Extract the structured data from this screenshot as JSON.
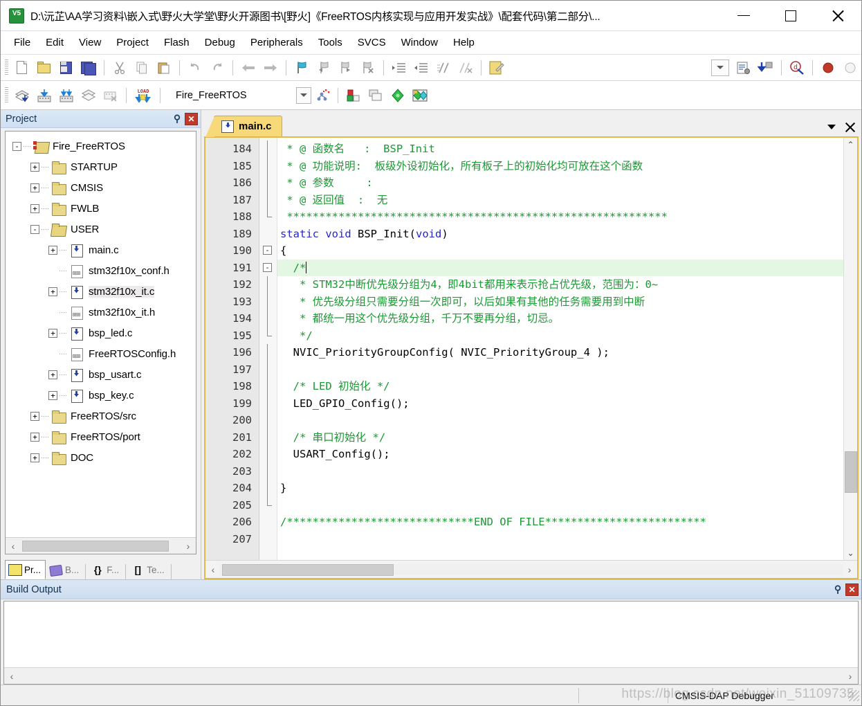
{
  "window": {
    "title": "D:\\沅芷\\AA学习资料\\嵌入式\\野火大学堂\\野火开源图书\\[野火]《FreeRTOS内核实现与应用开发实战》\\配套代码\\第二部分\\...",
    "logo_text": "V5",
    "minimize_label": "Minimize",
    "maximize_label": "Maximize",
    "close_label": "Close"
  },
  "menubar": {
    "items": [
      {
        "label": "File"
      },
      {
        "label": "Edit"
      },
      {
        "label": "View"
      },
      {
        "label": "Project"
      },
      {
        "label": "Flash"
      },
      {
        "label": "Debug"
      },
      {
        "label": "Peripherals"
      },
      {
        "label": "Tools"
      },
      {
        "label": "SVCS"
      },
      {
        "label": "Window"
      },
      {
        "label": "Help"
      }
    ]
  },
  "toolbar_main": {
    "buttons": [
      {
        "name": "new-file-icon",
        "tip": "New"
      },
      {
        "name": "open-file-icon",
        "tip": "Open"
      },
      {
        "name": "save-icon",
        "tip": "Save"
      },
      {
        "name": "save-all-icon",
        "tip": "Save All"
      },
      {
        "name": "cut-icon",
        "tip": "Cut"
      },
      {
        "name": "copy-icon",
        "tip": "Copy"
      },
      {
        "name": "paste-icon",
        "tip": "Paste"
      },
      {
        "name": "undo-icon",
        "tip": "Undo"
      },
      {
        "name": "redo-icon",
        "tip": "Redo"
      },
      {
        "name": "navigate-back-icon",
        "tip": "Back"
      },
      {
        "name": "navigate-forward-icon",
        "tip": "Forward"
      },
      {
        "name": "bookmark-toggle-icon",
        "tip": "Insert/Remove Bookmark"
      },
      {
        "name": "bookmark-prev-icon",
        "tip": "Go to Previous Bookmark"
      },
      {
        "name": "bookmark-next-icon",
        "tip": "Go to Next Bookmark"
      },
      {
        "name": "bookmark-clear-icon",
        "tip": "Clear All Bookmarks"
      },
      {
        "name": "indent-icon",
        "tip": "Indent"
      },
      {
        "name": "outdent-icon",
        "tip": "Outdent"
      },
      {
        "name": "comment-icon",
        "tip": "Comment Selection"
      },
      {
        "name": "uncomment-icon",
        "tip": "Uncomment Selection"
      },
      {
        "name": "configuration-wizard-icon",
        "tip": "Configuration Wizard"
      }
    ],
    "right_buttons": [
      {
        "name": "combo-chevron-icon",
        "tip": "Select"
      },
      {
        "name": "debug-settings-icon",
        "tip": "Debug Settings"
      },
      {
        "name": "download-icon",
        "tip": "Download"
      },
      {
        "name": "start-debug-icon",
        "tip": "Start/Stop Debug Session"
      },
      {
        "name": "record-icon",
        "tip": "Record"
      },
      {
        "name": "stop-icon",
        "tip": "Stop"
      }
    ]
  },
  "toolbar_build": {
    "buttons": [
      {
        "name": "translate-icon",
        "tip": "Translate Current File"
      },
      {
        "name": "build-icon",
        "tip": "Build"
      },
      {
        "name": "rebuild-icon",
        "tip": "Rebuild All"
      },
      {
        "name": "batch-build-icon",
        "tip": "Batch Build"
      },
      {
        "name": "stop-build-icon",
        "tip": "Stop Build"
      },
      {
        "name": "load-icon",
        "tip": "Download Code to Flash Memory"
      }
    ],
    "project_name": "Fire_FreeRTOS",
    "right_buttons": [
      {
        "name": "select-target-chevron-icon",
        "tip": "Select Target"
      },
      {
        "name": "manage-run-time-icon",
        "tip": "Manage Run-Time Environment"
      },
      {
        "name": "options-target-icon",
        "tip": "Options for Target"
      },
      {
        "name": "multi-project-icon",
        "tip": "Manage Multi-Project Workspace"
      },
      {
        "name": "pack-installer-icon",
        "tip": "Pack Installer"
      },
      {
        "name": "manage-project-items-icon",
        "tip": "Manage Project Items"
      }
    ]
  },
  "project_panel": {
    "title": "Project",
    "pin_label": "⚲",
    "close_label": "✕",
    "tree": [
      {
        "label": "Fire_FreeRTOS",
        "depth": 0,
        "expander": "-",
        "icon": "project-root-icon",
        "selected": false
      },
      {
        "label": "STARTUP",
        "depth": 1,
        "expander": "+",
        "icon": "folder-icon",
        "selected": false
      },
      {
        "label": "CMSIS",
        "depth": 1,
        "expander": "+",
        "icon": "folder-icon",
        "selected": false
      },
      {
        "label": "FWLB",
        "depth": 1,
        "expander": "+",
        "icon": "folder-icon",
        "selected": false
      },
      {
        "label": "USER",
        "depth": 1,
        "expander": "-",
        "icon": "folder-open-icon",
        "selected": false
      },
      {
        "label": "main.c",
        "depth": 2,
        "expander": "+",
        "icon": "c-file-icon",
        "selected": false
      },
      {
        "label": "stm32f10x_conf.h",
        "depth": 2,
        "expander": "",
        "icon": "h-file-icon",
        "selected": false
      },
      {
        "label": "stm32f10x_it.c",
        "depth": 2,
        "expander": "+",
        "icon": "c-file-icon",
        "selected": true
      },
      {
        "label": "stm32f10x_it.h",
        "depth": 2,
        "expander": "",
        "icon": "h-file-icon",
        "selected": false
      },
      {
        "label": "bsp_led.c",
        "depth": 2,
        "expander": "+",
        "icon": "c-file-icon",
        "selected": false
      },
      {
        "label": "FreeRTOSConfig.h",
        "depth": 2,
        "expander": "",
        "icon": "h-file-icon",
        "selected": false
      },
      {
        "label": "bsp_usart.c",
        "depth": 2,
        "expander": "+",
        "icon": "c-file-icon",
        "selected": false
      },
      {
        "label": "bsp_key.c",
        "depth": 2,
        "expander": "+",
        "icon": "c-file-icon",
        "selected": false
      },
      {
        "label": "FreeRTOS/src",
        "depth": 1,
        "expander": "+",
        "icon": "folder-icon",
        "selected": false
      },
      {
        "label": "FreeRTOS/port",
        "depth": 1,
        "expander": "+",
        "icon": "folder-icon",
        "selected": false
      },
      {
        "label": "DOC",
        "depth": 1,
        "expander": "+",
        "icon": "folder-icon",
        "selected": false
      }
    ],
    "tabs": [
      {
        "label": "Pr...",
        "icon": "project-tab-icon",
        "active": true
      },
      {
        "label": "B...",
        "icon": "books-tab-icon",
        "active": false
      },
      {
        "label": "F...",
        "icon": "functions-tab-icon",
        "active": false
      },
      {
        "label": "Te...",
        "icon": "templates-tab-icon",
        "active": false
      }
    ],
    "scroll_left_label": "‹",
    "scroll_right_label": "›"
  },
  "editor": {
    "tabs": [
      {
        "label": "main.c",
        "active": true,
        "icon": "c-file-icon"
      }
    ],
    "tab_menu_label": "▼",
    "tab_close_label": "✕",
    "first_line_number": 184,
    "lines": [
      {
        "n": 184,
        "fold": "bar",
        "segments": [
          {
            "t": " * @ 函数名   :  BSP_Init",
            "c": "cmt"
          }
        ]
      },
      {
        "n": 185,
        "fold": "bar",
        "segments": [
          {
            "t": " * @ 功能说明:  板级外设初始化，所有板子上的初始化均可放在这个函数",
            "c": "cmt"
          }
        ]
      },
      {
        "n": 186,
        "fold": "bar",
        "segments": [
          {
            "t": " * @ 参数     :",
            "c": "cmt"
          }
        ]
      },
      {
        "n": 187,
        "fold": "bar",
        "segments": [
          {
            "t": " * @ 返回值  :  无",
            "c": "cmt"
          }
        ]
      },
      {
        "n": 188,
        "fold": "end",
        "segments": [
          {
            "t": " ***********************************************************",
            "c": "cmt"
          }
        ]
      },
      {
        "n": 189,
        "fold": "",
        "segments": [
          {
            "t": "static void ",
            "c": "kw"
          },
          {
            "t": "BSP_Init(",
            "c": "txt"
          },
          {
            "t": "void",
            "c": "kw"
          },
          {
            "t": ")",
            "c": "txt"
          }
        ]
      },
      {
        "n": 190,
        "fold": "box-minus",
        "segments": [
          {
            "t": "{",
            "c": "txt"
          }
        ]
      },
      {
        "n": 191,
        "fold": "box-minus",
        "current": true,
        "caret": true,
        "segments": [
          {
            "t": "  /*",
            "c": "cmt"
          }
        ]
      },
      {
        "n": 192,
        "fold": "bar",
        "segments": [
          {
            "t": "   * STM32中断优先级分组为4，即4bit都用来表示抢占优先级，范围为：0~",
            "c": "cmt"
          }
        ]
      },
      {
        "n": 193,
        "fold": "bar",
        "segments": [
          {
            "t": "   * 优先级分组只需要分组一次即可，以后如果有其他的任务需要用到中断",
            "c": "cmt"
          }
        ]
      },
      {
        "n": 194,
        "fold": "bar",
        "segments": [
          {
            "t": "   * 都统一用这个优先级分组，千万不要再分组，切忌。",
            "c": "cmt"
          }
        ]
      },
      {
        "n": 195,
        "fold": "end",
        "segments": [
          {
            "t": "   */",
            "c": "cmt"
          }
        ]
      },
      {
        "n": 196,
        "fold": "bar",
        "segments": [
          {
            "t": "  NVIC_PriorityGroupConfig( NVIC_PriorityGroup_4 );",
            "c": "txt"
          }
        ]
      },
      {
        "n": 197,
        "fold": "bar",
        "segments": [
          {
            "t": "",
            "c": "txt"
          }
        ]
      },
      {
        "n": 198,
        "fold": "bar",
        "segments": [
          {
            "t": "  /* LED 初始化 */",
            "c": "cmt"
          }
        ]
      },
      {
        "n": 199,
        "fold": "bar",
        "segments": [
          {
            "t": "  LED_GPIO_Config();",
            "c": "txt"
          }
        ]
      },
      {
        "n": 200,
        "fold": "bar",
        "segments": [
          {
            "t": "",
            "c": "txt"
          }
        ]
      },
      {
        "n": 201,
        "fold": "bar",
        "segments": [
          {
            "t": "  /* 串口初始化 */",
            "c": "cmt"
          }
        ]
      },
      {
        "n": 202,
        "fold": "bar",
        "segments": [
          {
            "t": "  USART_Config();",
            "c": "txt"
          }
        ]
      },
      {
        "n": 203,
        "fold": "bar",
        "segments": [
          {
            "t": "",
            "c": "txt"
          }
        ]
      },
      {
        "n": 204,
        "fold": "bar",
        "segments": [
          {
            "t": "}",
            "c": "txt"
          }
        ]
      },
      {
        "n": 205,
        "fold": "end",
        "segments": [
          {
            "t": "",
            "c": "txt"
          }
        ]
      },
      {
        "n": 206,
        "fold": "",
        "segments": [
          {
            "t": "/*****************************END OF FILE*************************",
            "c": "cmt"
          }
        ]
      },
      {
        "n": 207,
        "fold": "",
        "segments": [
          {
            "t": "",
            "c": "txt"
          }
        ]
      }
    ],
    "scroll_up_label": "⌃",
    "scroll_down_label": "⌄",
    "scroll_left_label": "‹",
    "scroll_right_label": "›"
  },
  "build_output": {
    "title": "Build Output",
    "pin_label": "⚲",
    "close_label": "✕",
    "text": "",
    "scroll_left_label": "‹",
    "scroll_right_label": "›"
  },
  "statusbar": {
    "debugger": "CMSIS-DAP Debugger",
    "watermark": "https://blog.csdn.net/weixin_51109735"
  },
  "colors": {
    "comment_green": "#1a9a32",
    "keyword_blue": "#2525cc",
    "tab_yellow": "#f7d97a",
    "caption_blue": "#cfe0f2",
    "current_line": "#e3f7e3"
  }
}
